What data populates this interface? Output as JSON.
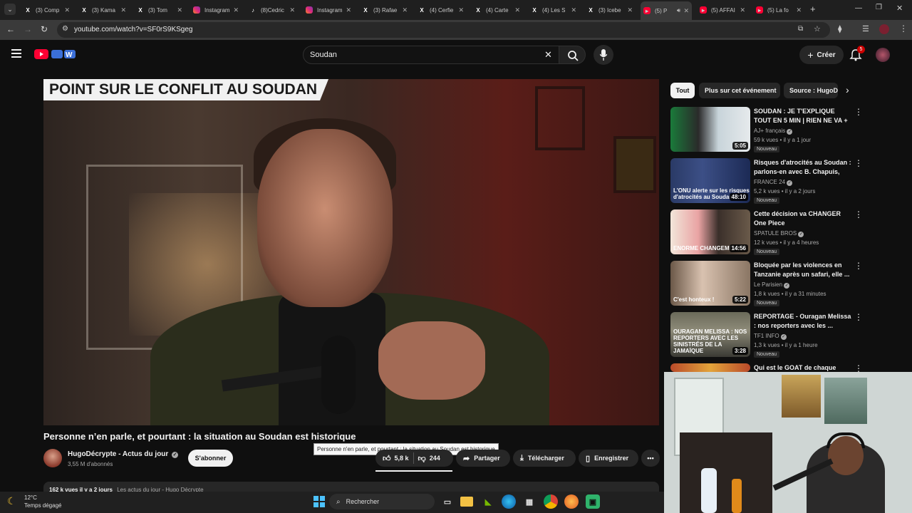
{
  "browser": {
    "tabs": [
      {
        "label": "(3) Comp",
        "icon": "x-logo"
      },
      {
        "label": "(3) Kama",
        "icon": "x-logo"
      },
      {
        "label": "(3) Tom",
        "icon": "x-logo"
      },
      {
        "label": "Instagram",
        "icon": "instagram-logo"
      },
      {
        "label": "(8)Cedric",
        "icon": "tiktok-logo"
      },
      {
        "label": "Instagram",
        "icon": "instagram-logo"
      },
      {
        "label": "(3) Rafae",
        "icon": "x-logo"
      },
      {
        "label": "(4) Cerfie",
        "icon": "x-logo"
      },
      {
        "label": "(4) Carte",
        "icon": "x-logo"
      },
      {
        "label": "(4) Les S",
        "icon": "x-logo"
      },
      {
        "label": "(3) Icebe",
        "icon": "x-logo"
      },
      {
        "label": "(5) P",
        "icon": "youtube-logo",
        "active": true
      },
      {
        "label": "(5) AFFAI",
        "icon": "youtube-logo"
      },
      {
        "label": "(5) La fo",
        "icon": "youtube-logo"
      }
    ],
    "url": "youtube.com/watch?v=SF0rS9KSgeg"
  },
  "youtube": {
    "search_query": "Soudan",
    "create_label": "Créer",
    "notifications_count": "5"
  },
  "video": {
    "banner": "POINT SUR LE CONFLIT AU SOUDAN",
    "title": "Personne n’en parle, et pourtant : la situation au Soudan est historique",
    "tooltip": "Personne n'en parle, et pourtant : la situation au Soudan est historique",
    "channel": "HugoDécrypte - Actus du jour",
    "subscribers": "3,55 M d'abonnés",
    "subscribe_label": "S'abonner",
    "likes": "5,8 k",
    "dislikes": "244",
    "share_label": "Partager",
    "download_label": "Télécharger",
    "save_label": "Enregistrer",
    "desc_views": "162 k vues  il y a 2 jours",
    "desc_tags": "Les actus du jour - Hugo Décrypte"
  },
  "sidebar": {
    "chips": [
      "Tout",
      "Plus sur cet événement",
      "Source : HugoD"
    ],
    "items": [
      {
        "title": "SOUDAN : JE T'EXPLIQUE TOUT EN 5 MIN | RIEN NE VA +",
        "channel": "AJ+ français",
        "meta": "59 k vues • il y a 1 jour",
        "badge": "Nouveau",
        "duration": "5:05",
        "thumb_text": ""
      },
      {
        "title": "Risques d'atrocités au Soudan : parlons-en avec B. Chapuis, M...",
        "channel": "FRANCE 24",
        "meta": "5,2 k vues • il y a 2 jours",
        "badge": "Nouveau",
        "duration": "48:10",
        "thumb_text": "L'ONU alerte sur les risques d'atrocités au Soudan"
      },
      {
        "title": "Cette décision va CHANGER One Piece",
        "channel": "SPATULE BROS",
        "meta": "12 k vues • il y a 4 heures",
        "badge": "Nouveau",
        "duration": "14:56",
        "thumb_text": "ENORME CHANGEMENT"
      },
      {
        "title": "Bloquée par les violences en Tanzanie après un safari, elle ...",
        "channel": "Le Parisien",
        "meta": "1,8 k vues • il y a 31 minutes",
        "badge": "Nouveau",
        "duration": "5:22",
        "thumb_text": "C'est honteux !"
      },
      {
        "title": "REPORTAGE - Ouragan Melissa : nos reporters avec les ...",
        "channel": "TF1 INFO",
        "meta": "1,3 k vues • il y a 1 heure",
        "badge": "Nouveau",
        "duration": "3:28",
        "thumb_text": "OURAGAN MELISSA : NOS REPORTERS AVEC LES SINISTRÉS DE LA JAMAÏQUE"
      },
      {
        "title": "Qui est le GOAT de chaque",
        "channel": "",
        "meta": "",
        "badge": "",
        "duration": "",
        "thumb_text": ""
      }
    ]
  },
  "taskbar": {
    "weather_temp": "12°C",
    "weather_desc": "Temps dégagé",
    "search_label": "Rechercher"
  },
  "colors": {
    "youtube_red": "#ff0033",
    "background": "#0f0f0f"
  }
}
